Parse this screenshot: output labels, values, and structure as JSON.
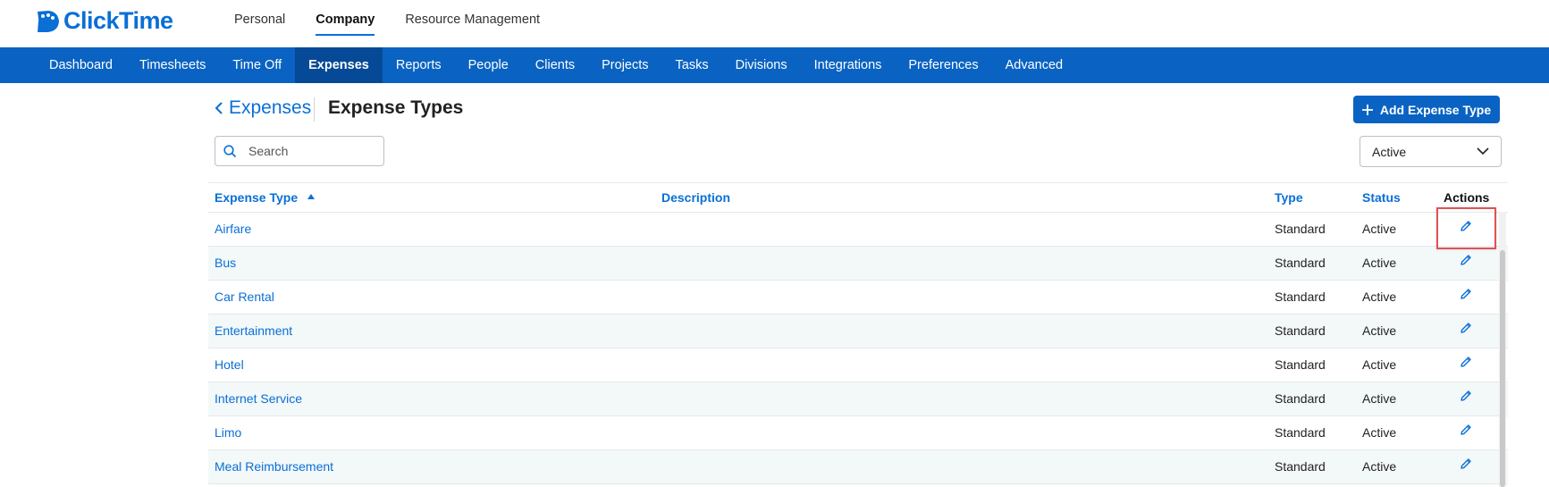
{
  "brand": {
    "name": "ClickTime"
  },
  "top_nav": [
    {
      "label": "Personal",
      "active": false
    },
    {
      "label": "Company",
      "active": true
    },
    {
      "label": "Resource Management",
      "active": false
    }
  ],
  "main_nav": [
    {
      "label": "Dashboard",
      "active": false
    },
    {
      "label": "Timesheets",
      "active": false
    },
    {
      "label": "Time Off",
      "active": false
    },
    {
      "label": "Expenses",
      "active": true
    },
    {
      "label": "Reports",
      "active": false
    },
    {
      "label": "People",
      "active": false
    },
    {
      "label": "Clients",
      "active": false
    },
    {
      "label": "Projects",
      "active": false
    },
    {
      "label": "Tasks",
      "active": false
    },
    {
      "label": "Divisions",
      "active": false
    },
    {
      "label": "Integrations",
      "active": false
    },
    {
      "label": "Preferences",
      "active": false
    },
    {
      "label": "Advanced",
      "active": false
    }
  ],
  "header": {
    "back_label": "Expenses",
    "title": "Expense Types",
    "add_button_label": "Add Expense Type"
  },
  "search": {
    "placeholder": "Search",
    "value": ""
  },
  "status_filter": {
    "selected": "Active"
  },
  "table": {
    "columns": {
      "expense_type": "Expense Type",
      "description": "Description",
      "type": "Type",
      "status": "Status",
      "actions": "Actions"
    },
    "sort": {
      "column": "expense_type",
      "direction": "ascending"
    },
    "rows": [
      {
        "name": "Airfare",
        "description": "",
        "type": "Standard",
        "status": "Active"
      },
      {
        "name": "Bus",
        "description": "",
        "type": "Standard",
        "status": "Active"
      },
      {
        "name": "Car Rental",
        "description": "",
        "type": "Standard",
        "status": "Active"
      },
      {
        "name": "Entertainment",
        "description": "",
        "type": "Standard",
        "status": "Active"
      },
      {
        "name": "Hotel",
        "description": "",
        "type": "Standard",
        "status": "Active"
      },
      {
        "name": "Internet Service",
        "description": "",
        "type": "Standard",
        "status": "Active"
      },
      {
        "name": "Limo",
        "description": "",
        "type": "Standard",
        "status": "Active"
      },
      {
        "name": "Meal Reimbursement",
        "description": "",
        "type": "Standard",
        "status": "Active"
      }
    ]
  },
  "icons": {
    "logo": "clicktime-logo-icon",
    "back": "chevron-left-icon",
    "add": "plus-icon",
    "search": "search-icon",
    "dropdown": "chevron-down-icon",
    "edit": "pencil-icon"
  },
  "colors": {
    "brand_blue": "#0a6fd6",
    "nav_blue": "#0a63c2",
    "nav_active": "#064a97",
    "row_stripe": "#f3f8f9",
    "highlight": "#e05252"
  }
}
